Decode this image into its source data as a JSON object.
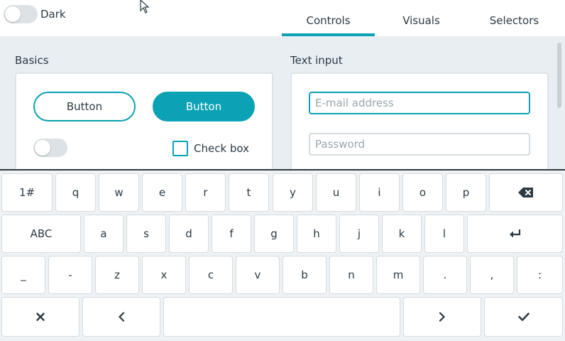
{
  "header": {
    "theme_label": "Dark",
    "tabs": [
      {
        "label": "Controls",
        "active": true
      },
      {
        "label": "Visuals",
        "active": false
      },
      {
        "label": "Selectors",
        "active": false
      }
    ]
  },
  "basics": {
    "title": "Basics",
    "button_outline_label": "Button",
    "button_solid_label": "Button",
    "switch_on": false,
    "checkbox_label": "Check box",
    "checkbox_checked": false
  },
  "text_input": {
    "title": "Text input",
    "email_placeholder": "E-mail address",
    "password_placeholder": "Password"
  },
  "keyboard": {
    "row1": [
      "1#",
      "q",
      "w",
      "e",
      "r",
      "t",
      "y",
      "u",
      "i",
      "o",
      "p"
    ],
    "row2": [
      "ABC",
      "a",
      "s",
      "d",
      "f",
      "g",
      "h",
      "j",
      "k",
      "l"
    ],
    "row3": [
      "_",
      "-",
      "z",
      "x",
      "c",
      "v",
      "b",
      "n",
      "m",
      ".",
      ",",
      ":"
    ],
    "icons": {
      "backspace": "backspace-icon",
      "enter": "enter-icon",
      "close": "close-icon",
      "left": "chevron-left-icon",
      "right": "chevron-right-icon",
      "ok": "checkmark-icon"
    }
  },
  "colors": {
    "accent": "#0aa2b4",
    "background": "#e9eef2",
    "text": "#2c3a44"
  }
}
